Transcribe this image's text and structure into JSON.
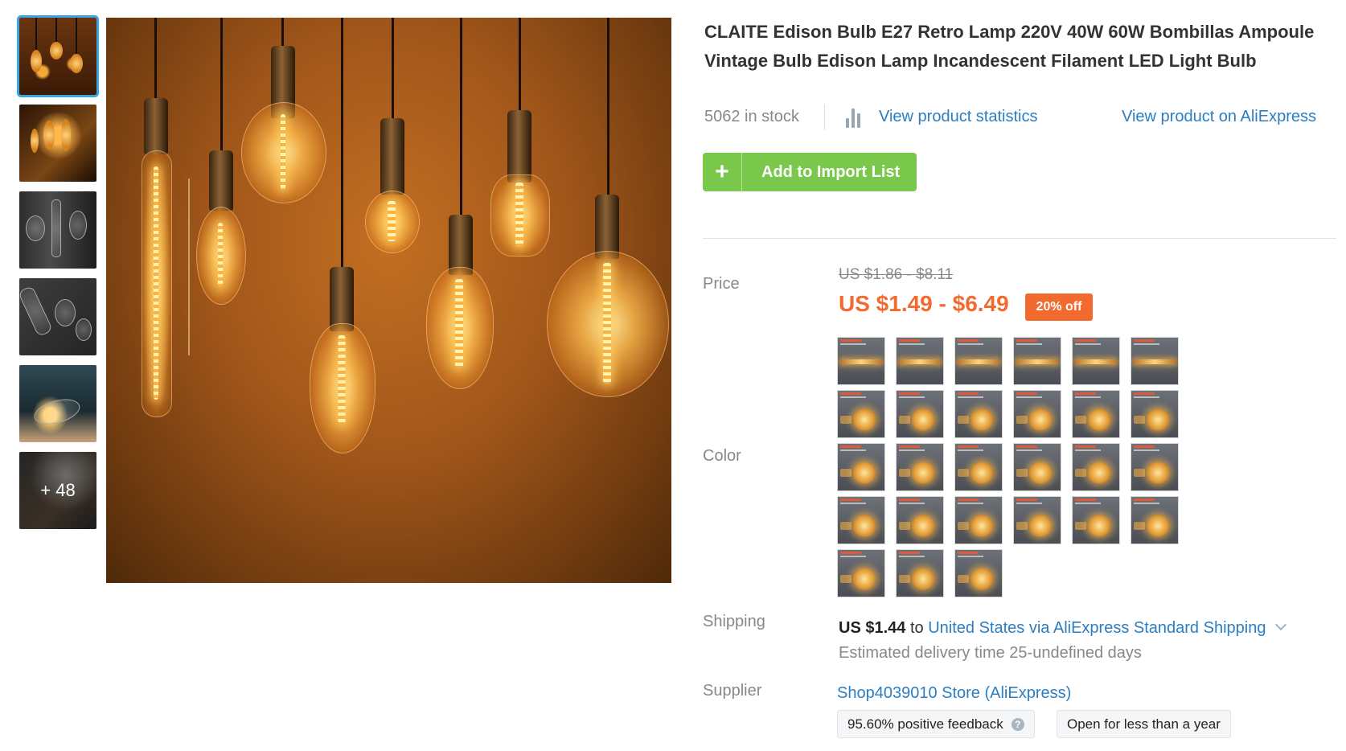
{
  "product": {
    "title": "CLAITE Edison Bulb E27 Retro Lamp 220V 40W 60W Bombillas Ampoule Vintage Bulb Edison Lamp Incandescent Filament LED Light Bulb",
    "stock": "5062 in stock",
    "view_stats": "View product statistics",
    "view_ali": "View product on AliExpress",
    "add_button": "Add to Import List",
    "add_icon": "+"
  },
  "gallery": {
    "more_count": "+ 48",
    "thumbnail_count": 6,
    "active_index": 0
  },
  "price": {
    "label": "Price",
    "original": "US $1.86 - $8.11",
    "current": "US $1.49 - $6.49",
    "discount": "20% off"
  },
  "color": {
    "label": "Color",
    "swatch_count": 27
  },
  "shipping": {
    "label": "Shipping",
    "cost": "US $1.44",
    "to": "to",
    "method": "United States via AliExpress Standard Shipping",
    "estimate": "Estimated delivery time 25-undefined days"
  },
  "supplier": {
    "label": "Supplier",
    "name": "Shop4039010 Store (AliExpress)",
    "feedback": "95.60% positive feedback",
    "age": "Open for less than a year"
  },
  "colors": {
    "accent_green": "#79c84c",
    "price_orange": "#f26a2e",
    "link_blue": "#2b7ec1",
    "thumb_active_border": "#3aa3e3"
  },
  "icons": [
    "plus-icon",
    "bar-chart-icon",
    "chevron-down-icon",
    "help-icon"
  ]
}
